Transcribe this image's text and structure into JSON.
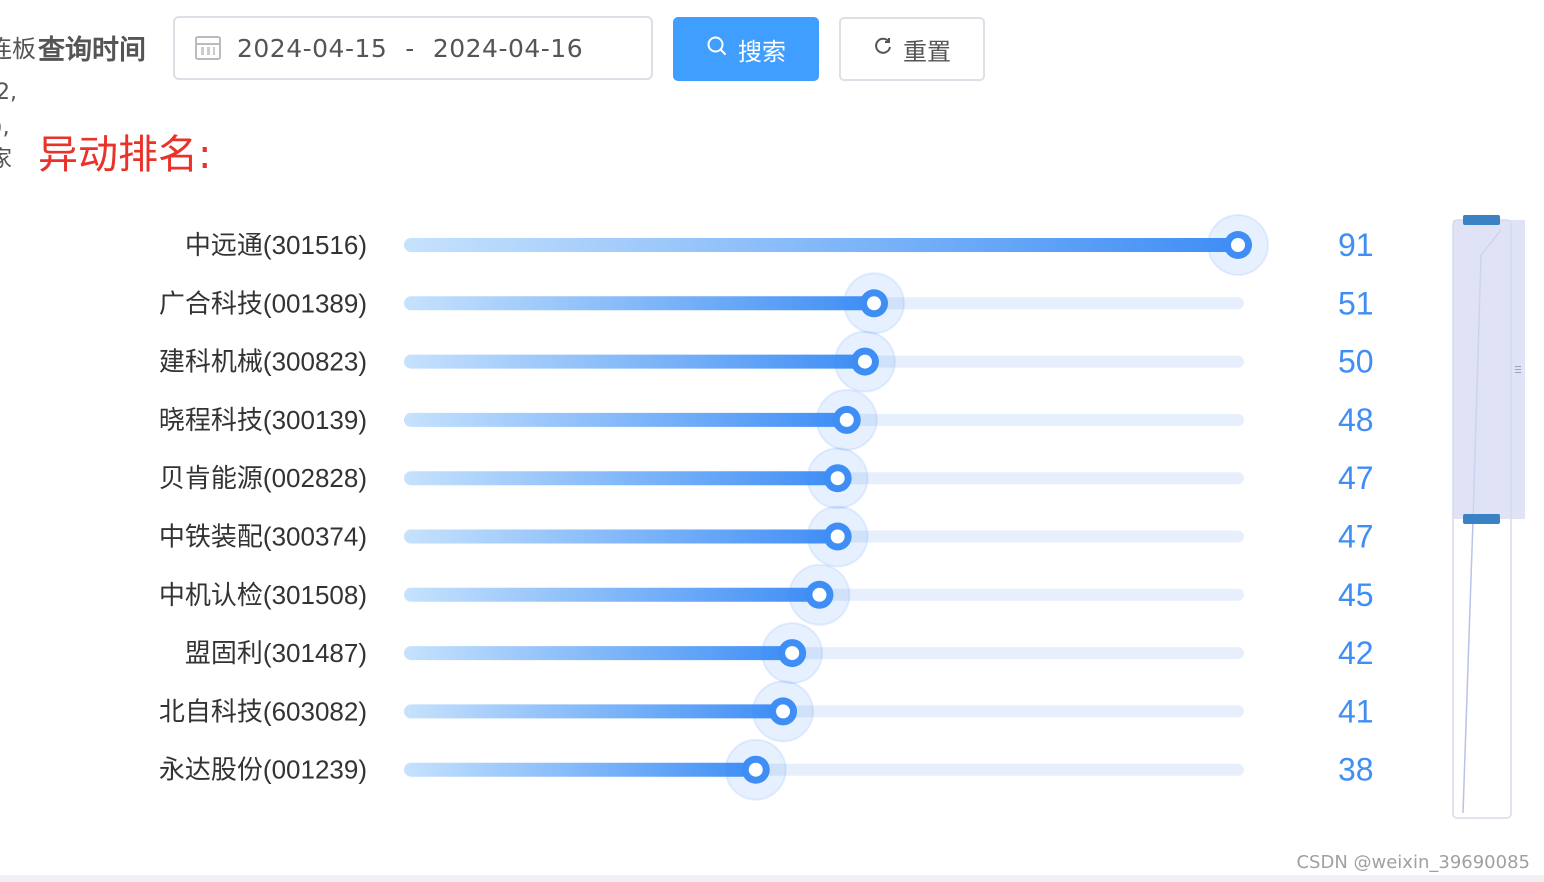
{
  "left_fragments": [
    "连板",
    "2,",
    "),",
    "家"
  ],
  "query": {
    "label": "查询时间",
    "start_date": "2024-04-15",
    "separator": "-",
    "end_date": "2024-04-16"
  },
  "buttons": {
    "search_label": "搜索",
    "reset_label": "重置"
  },
  "section_title": "异动排名:",
  "watermark": "CSDN @weixin_39690085",
  "colors": {
    "accent": "#409eff",
    "title_red": "#e8322a",
    "bar_start": "#c6e2fd",
    "bar_end": "#3f8ef5",
    "track": "#e6effb",
    "value_text": "#3f8ef5"
  },
  "chart_data": {
    "type": "bar",
    "orientation": "horizontal",
    "categories": [
      "中远通(301516)",
      "广合科技(001389)",
      "建科机械(300823)",
      "晓程科技(300139)",
      "贝肯能源(002828)",
      "中铁装配(300374)",
      "中机认检(301508)",
      "盟固利(301487)",
      "北自科技(603082)",
      "永达股份(001239)"
    ],
    "values": [
      91,
      51,
      50,
      48,
      47,
      47,
      45,
      42,
      41,
      38
    ],
    "xlim": [
      0,
      91
    ],
    "grid": false,
    "legend": "none",
    "datazoom": {
      "type": "slider",
      "orientation": "vertical",
      "position": "right",
      "start_percent": 0,
      "end_percent": 50
    }
  }
}
